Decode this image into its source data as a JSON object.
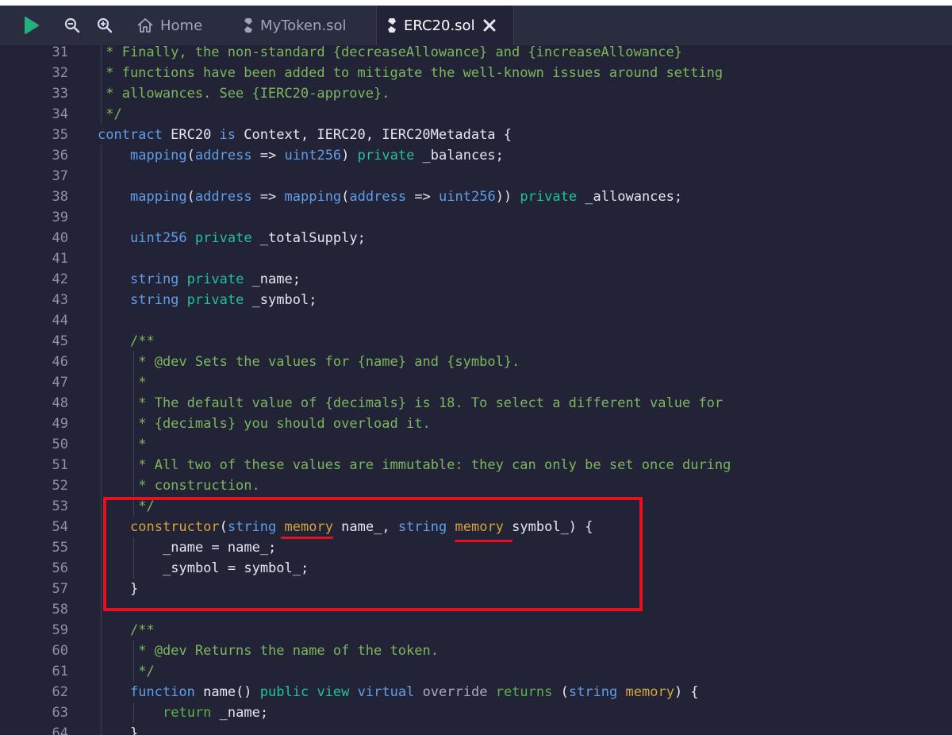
{
  "toolbar": {
    "run_icon": "play-icon",
    "zoom_out_icon": "zoom-out-icon",
    "zoom_in_icon": "zoom-in-icon"
  },
  "tabs": [
    {
      "label": "Home",
      "icon": "home-icon",
      "active": false
    },
    {
      "label": "MyToken.sol",
      "icon": "solidity-icon",
      "active": false
    },
    {
      "label": "ERC20.sol",
      "icon": "solidity-icon",
      "active": true,
      "close_icon": "close-icon"
    }
  ],
  "colors": {
    "comment": "#7cb75b",
    "keyword": "#5f9ee8",
    "keyword_alt": "#1ec39a",
    "memory": "#d5a43a",
    "highlight": "#e8101f"
  },
  "code": {
    "lines": [
      {
        "n": "31",
        "indent": 0,
        "tokens": [
          {
            "c": "cmt",
            "t": " * Finally, the non-standard {decreaseAllowance} and {increaseAllowance}"
          }
        ]
      },
      {
        "n": "32",
        "indent": 0,
        "tokens": [
          {
            "c": "cmt",
            "t": " * functions have been added to mitigate the well-known issues around setting"
          }
        ]
      },
      {
        "n": "33",
        "indent": 0,
        "tokens": [
          {
            "c": "cmt",
            "t": " * allowances. See {IERC20-approve}."
          }
        ]
      },
      {
        "n": "34",
        "indent": 0,
        "tokens": [
          {
            "c": "cmt",
            "t": " */"
          }
        ]
      },
      {
        "n": "35",
        "indent": 0,
        "tokens": [
          {
            "c": "kw",
            "t": "contract"
          },
          {
            "c": "pl",
            "t": " ERC20 "
          },
          {
            "c": "kw",
            "t": "is"
          },
          {
            "c": "pl",
            "t": " Context, IERC20, IERC20Metadata {"
          }
        ]
      },
      {
        "n": "36",
        "indent": 1,
        "tokens": [
          {
            "c": "kw",
            "t": "mapping"
          },
          {
            "c": "pl",
            "t": "("
          },
          {
            "c": "kw",
            "t": "address"
          },
          {
            "c": "pl",
            "t": " => "
          },
          {
            "c": "kw",
            "t": "uint256"
          },
          {
            "c": "pl",
            "t": ") "
          },
          {
            "c": "kwg",
            "t": "private"
          },
          {
            "c": "pl",
            "t": " _balances;"
          }
        ]
      },
      {
        "n": "37",
        "indent": 1,
        "tokens": []
      },
      {
        "n": "38",
        "indent": 1,
        "tokens": [
          {
            "c": "kw",
            "t": "mapping"
          },
          {
            "c": "pl",
            "t": "("
          },
          {
            "c": "kw",
            "t": "address"
          },
          {
            "c": "pl",
            "t": " => "
          },
          {
            "c": "kw",
            "t": "mapping"
          },
          {
            "c": "pl",
            "t": "("
          },
          {
            "c": "kw",
            "t": "address"
          },
          {
            "c": "pl",
            "t": " => "
          },
          {
            "c": "kw",
            "t": "uint256"
          },
          {
            "c": "pl",
            "t": ")) "
          },
          {
            "c": "kwg",
            "t": "private"
          },
          {
            "c": "pl",
            "t": " _allowances;"
          }
        ]
      },
      {
        "n": "39",
        "indent": 1,
        "tokens": []
      },
      {
        "n": "40",
        "indent": 1,
        "tokens": [
          {
            "c": "kw",
            "t": "uint256"
          },
          {
            "c": "pl",
            "t": " "
          },
          {
            "c": "kwg",
            "t": "private"
          },
          {
            "c": "pl",
            "t": " _totalSupply;"
          }
        ]
      },
      {
        "n": "41",
        "indent": 1,
        "tokens": []
      },
      {
        "n": "42",
        "indent": 1,
        "tokens": [
          {
            "c": "kw",
            "t": "string"
          },
          {
            "c": "pl",
            "t": " "
          },
          {
            "c": "kwg",
            "t": "private"
          },
          {
            "c": "pl",
            "t": " _name;"
          }
        ]
      },
      {
        "n": "43",
        "indent": 1,
        "tokens": [
          {
            "c": "kw",
            "t": "string"
          },
          {
            "c": "pl",
            "t": " "
          },
          {
            "c": "kwg",
            "t": "private"
          },
          {
            "c": "pl",
            "t": " _symbol;"
          }
        ]
      },
      {
        "n": "44",
        "indent": 1,
        "tokens": []
      },
      {
        "n": "45",
        "indent": 1,
        "tokens": [
          {
            "c": "cmt",
            "t": "/**"
          }
        ]
      },
      {
        "n": "46",
        "indent": 1,
        "tokens": [
          {
            "c": "cmt",
            "t": " * @dev Sets the values for {name} and {symbol}."
          }
        ]
      },
      {
        "n": "47",
        "indent": 1,
        "tokens": [
          {
            "c": "cmt",
            "t": " *"
          }
        ]
      },
      {
        "n": "48",
        "indent": 1,
        "tokens": [
          {
            "c": "cmt",
            "t": " * The default value of {decimals} is 18. To select a different value for"
          }
        ]
      },
      {
        "n": "49",
        "indent": 1,
        "tokens": [
          {
            "c": "cmt",
            "t": " * {decimals} you should overload it."
          }
        ]
      },
      {
        "n": "50",
        "indent": 1,
        "tokens": [
          {
            "c": "cmt",
            "t": " *"
          }
        ]
      },
      {
        "n": "51",
        "indent": 1,
        "tokens": [
          {
            "c": "cmt",
            "t": " * All two of these values are immutable: they can only be set once during"
          }
        ]
      },
      {
        "n": "52",
        "indent": 1,
        "tokens": [
          {
            "c": "cmt",
            "t": " * construction."
          }
        ]
      },
      {
        "n": "53",
        "indent": 1,
        "tokens": [
          {
            "c": "cmt",
            "t": " */"
          }
        ]
      },
      {
        "n": "54",
        "indent": 1,
        "tokens": [
          {
            "c": "mem",
            "t": "constructor"
          },
          {
            "c": "pl",
            "t": "("
          },
          {
            "c": "kw",
            "t": "string"
          },
          {
            "c": "pl",
            "t": " "
          },
          {
            "c": "mem",
            "t": "memory"
          },
          {
            "c": "pl",
            "t": " name_, "
          },
          {
            "c": "kw",
            "t": "string"
          },
          {
            "c": "pl",
            "t": " "
          },
          {
            "c": "mem",
            "t": "memory"
          },
          {
            "c": "pl",
            "t": " symbol_) {"
          }
        ]
      },
      {
        "n": "55",
        "indent": 2,
        "tokens": [
          {
            "c": "pl",
            "t": "_name = name_;"
          }
        ]
      },
      {
        "n": "56",
        "indent": 2,
        "tokens": [
          {
            "c": "pl",
            "t": "_symbol = symbol_;"
          }
        ]
      },
      {
        "n": "57",
        "indent": 1,
        "tokens": [
          {
            "c": "pl",
            "t": "}"
          }
        ]
      },
      {
        "n": "58",
        "indent": 1,
        "tokens": []
      },
      {
        "n": "59",
        "indent": 1,
        "tokens": [
          {
            "c": "cmt",
            "t": "/**"
          }
        ]
      },
      {
        "n": "60",
        "indent": 1,
        "tokens": [
          {
            "c": "cmt",
            "t": " * @dev Returns the name of the token."
          }
        ]
      },
      {
        "n": "61",
        "indent": 1,
        "tokens": [
          {
            "c": "cmt",
            "t": " */"
          }
        ]
      },
      {
        "n": "62",
        "indent": 1,
        "tokens": [
          {
            "c": "kw",
            "t": "function"
          },
          {
            "c": "pl",
            "t": " name() "
          },
          {
            "c": "kwg",
            "t": "public"
          },
          {
            "c": "pl",
            "t": " "
          },
          {
            "c": "kwg",
            "t": "view"
          },
          {
            "c": "pl",
            "t": " "
          },
          {
            "c": "kw",
            "t": "virtual"
          },
          {
            "c": "pl",
            "t": " "
          },
          {
            "c": "ov",
            "t": "override"
          },
          {
            "c": "pl",
            "t": " "
          },
          {
            "c": "ret",
            "t": "returns"
          },
          {
            "c": "pl",
            "t": " ("
          },
          {
            "c": "kw",
            "t": "string"
          },
          {
            "c": "pl",
            "t": " "
          },
          {
            "c": "mem",
            "t": "memory"
          },
          {
            "c": "pl",
            "t": ") {"
          }
        ]
      },
      {
        "n": "63",
        "indent": 2,
        "tokens": [
          {
            "c": "ret",
            "t": "return"
          },
          {
            "c": "pl",
            "t": " _name;"
          }
        ]
      },
      {
        "n": "64",
        "indent": 1,
        "tokens": [
          {
            "c": "pl",
            "t": "}"
          }
        ]
      }
    ]
  }
}
